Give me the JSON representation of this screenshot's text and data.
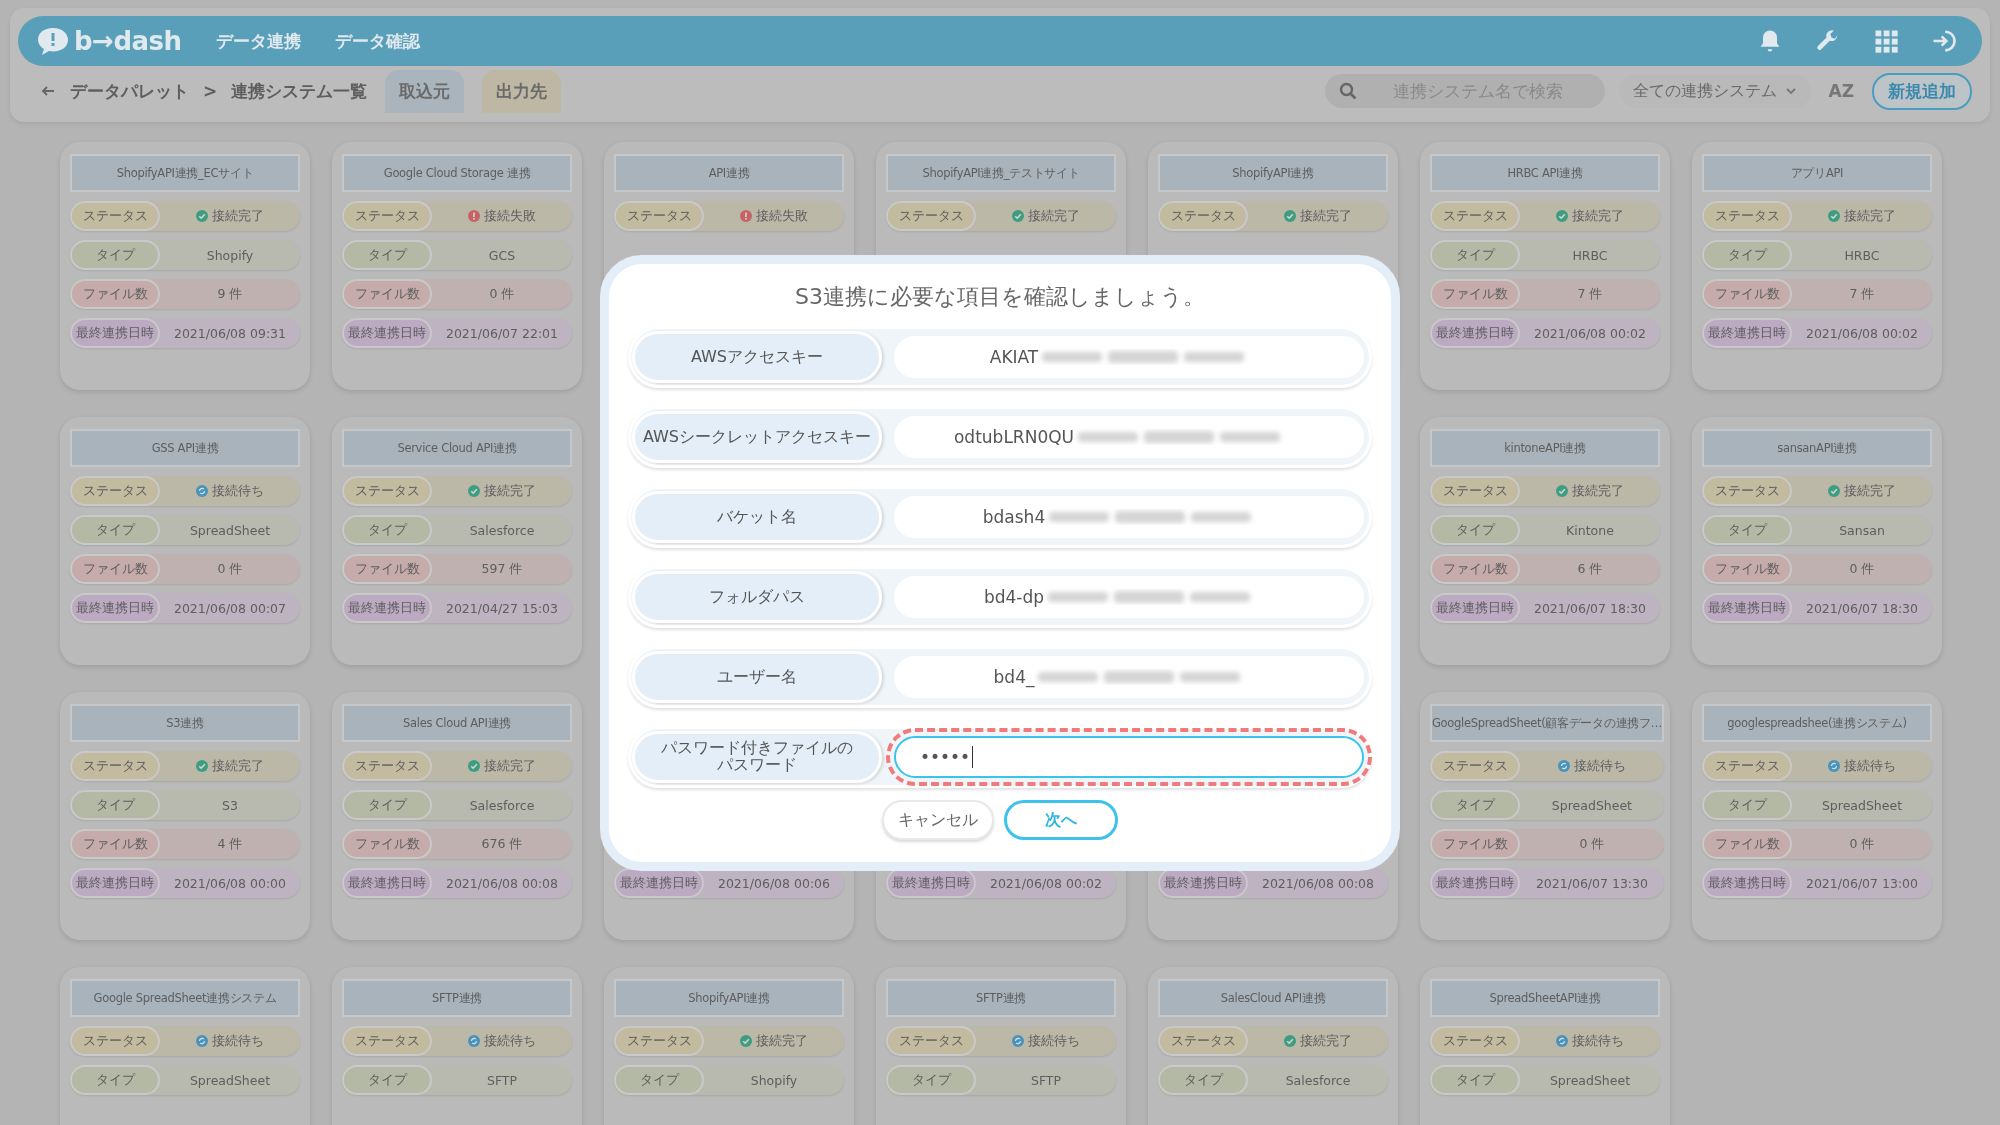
{
  "header": {
    "logo": "b→dash",
    "nav": [
      {
        "label": "データ連携"
      },
      {
        "label": "データ確認"
      }
    ]
  },
  "toolbar": {
    "breadcrumb": [
      "データパレット",
      ">",
      "連携システム一覧"
    ],
    "tabs": [
      {
        "label": "取込元",
        "selected": true
      },
      {
        "label": "出力先",
        "selected": false
      }
    ],
    "search": {
      "placeholder": "連携システム名で検索"
    },
    "filter": "全ての連携システム",
    "sort": "AZ",
    "add_button": "新規追加"
  },
  "left_cards": [
    {
      "title": "ShopifyAPI連携_ECサイト",
      "rows": [
        {
          "kind": "ok",
          "label": "ステータス",
          "value": "接続完了"
        },
        {
          "kind": "type",
          "label": "タイプ",
          "value": "Shopify"
        },
        {
          "kind": "files",
          "label": "ファイル数",
          "value": "9 件"
        },
        {
          "kind": "date",
          "label": "最終連携日時",
          "value": "2021/06/08 09:31"
        }
      ]
    },
    {
      "title": "Google Cloud Storage 連携",
      "rows": [
        {
          "kind": "error",
          "label": "ステータス",
          "value": "接続失敗"
        },
        {
          "kind": "type",
          "label": "タイプ",
          "value": "GCS"
        },
        {
          "kind": "files",
          "label": "ファイル数",
          "value": "0 件"
        },
        {
          "kind": "date",
          "label": "最終連携日時",
          "value": "2021/06/07 22:01"
        }
      ]
    },
    {
      "title": "GSS API連携",
      "rows": [
        {
          "kind": "waiting",
          "label": "ステータス",
          "value": "接続待ち"
        },
        {
          "kind": "type",
          "label": "タイプ",
          "value": "SpreadSheet"
        },
        {
          "kind": "files",
          "label": "ファイル数",
          "value": "0 件"
        },
        {
          "kind": "date",
          "label": "最終連携日時",
          "value": "2021/06/08 00:07"
        }
      ]
    },
    {
      "title": "Service Cloud API連携",
      "rows": [
        {
          "kind": "ok",
          "label": "ステータス",
          "value": "接続完了"
        },
        {
          "kind": "type",
          "label": "タイプ",
          "value": "Salesforce"
        },
        {
          "kind": "files",
          "label": "ファイル数",
          "value": "597 件"
        },
        {
          "kind": "date",
          "label": "最終連携日時",
          "value": "2021/04/27 15:03"
        }
      ]
    },
    {
      "title": "S3連携",
      "rows": [
        {
          "kind": "ok",
          "label": "ステータス",
          "value": "接続完了"
        },
        {
          "kind": "type",
          "label": "タイプ",
          "value": "S3"
        },
        {
          "kind": "files",
          "label": "ファイル数",
          "value": "4 件"
        },
        {
          "kind": "date",
          "label": "最終連携日時",
          "value": "2021/06/08 00:00"
        }
      ]
    },
    {
      "title": "Sales Cloud API連携",
      "rows": [
        {
          "kind": "ok",
          "label": "ステータス",
          "value": "接続完了"
        },
        {
          "kind": "type",
          "label": "タイプ",
          "value": "Salesforce"
        },
        {
          "kind": "files",
          "label": "ファイル数",
          "value": "676 件"
        },
        {
          "kind": "date",
          "label": "最終連携日時",
          "value": "2021/06/08 00:08"
        }
      ]
    },
    {
      "title": "Google SpreadSheet連携システム",
      "rows": [
        {
          "kind": "waiting",
          "label": "ステータス",
          "value": "接続待ち"
        },
        {
          "kind": "type",
          "label": "タイプ",
          "value": "SpreadSheet"
        }
      ]
    },
    {
      "title": "SFTP連携",
      "rows": [
        {
          "kind": "waiting",
          "label": "ステータス",
          "value": "接続待ち"
        },
        {
          "kind": "type",
          "label": "タイプ",
          "value": "SFTP"
        }
      ]
    }
  ],
  "middle_cards": [
    {
      "title": "API連携",
      "rows": [
        {
          "kind": "error",
          "label": "ステータス",
          "value": "接続失敗"
        }
      ]
    },
    {
      "title": "ShopifyAPI連携_テストサイト",
      "rows": [
        {
          "kind": "ok",
          "label": "ステータス",
          "value": "接続完了"
        }
      ]
    },
    {
      "title": "ShopifyAPI連携",
      "rows": [
        {
          "kind": "ok",
          "label": "ステータス",
          "value": "接続完了"
        }
      ]
    },
    {
      "rows": [
        {
          "kind": "date",
          "label": "最終連携日時",
          "value": "2021/06/08 00:06"
        }
      ]
    },
    {
      "rows": [
        {
          "kind": "date",
          "label": "最終連携日時",
          "value": "2021/06/08 00:02"
        }
      ]
    },
    {
      "rows": [
        {
          "kind": "date",
          "label": "最終連携日時",
          "value": "2021/06/08 00:08"
        }
      ]
    },
    {
      "title": "ShopifyAPI連携",
      "rows": [
        {
          "kind": "ok",
          "label": "ステータス",
          "value": "接続完了"
        },
        {
          "kind": "type",
          "label": "タイプ",
          "value": "Shopify"
        }
      ]
    },
    {
      "title": "SFTP連携",
      "rows": [
        {
          "kind": "waiting",
          "label": "ステータス",
          "value": "接続待ち"
        },
        {
          "kind": "type",
          "label": "タイプ",
          "value": "SFTP"
        }
      ]
    },
    {
      "title": "SalesCloud API連携",
      "rows": [
        {
          "kind": "ok",
          "label": "ステータス",
          "value": "接続完了"
        },
        {
          "kind": "type",
          "label": "タイプ",
          "value": "Salesforce"
        }
      ]
    }
  ],
  "right_cards": [
    {
      "title": "HRBC API連携",
      "rows": [
        {
          "kind": "ok",
          "label": "ステータス",
          "value": "接続完了"
        },
        {
          "kind": "type",
          "label": "タイプ",
          "value": "HRBC"
        },
        {
          "kind": "files",
          "label": "ファイル数",
          "value": "7 件"
        },
        {
          "kind": "date",
          "label": "最終連携日時",
          "value": "2021/06/08 00:02"
        }
      ]
    },
    {
      "title": "アプリAPI",
      "rows": [
        {
          "kind": "ok",
          "label": "ステータス",
          "value": "接続完了"
        },
        {
          "kind": "type",
          "label": "タイプ",
          "value": "HRBC"
        },
        {
          "kind": "files",
          "label": "ファイル数",
          "value": "7 件"
        },
        {
          "kind": "date",
          "label": "最終連携日時",
          "value": "2021/06/08 00:02"
        }
      ]
    },
    {
      "title": "kintoneAPI連携",
      "rows": [
        {
          "kind": "ok",
          "label": "ステータス",
          "value": "接続完了"
        },
        {
          "kind": "type",
          "label": "タイプ",
          "value": "Kintone"
        },
        {
          "kind": "files",
          "label": "ファイル数",
          "value": "6 件"
        },
        {
          "kind": "date",
          "label": "最終連携日時",
          "value": "2021/06/07 18:30"
        }
      ]
    },
    {
      "title": "sansanAPI連携",
      "rows": [
        {
          "kind": "ok",
          "label": "ステータス",
          "value": "接続完了"
        },
        {
          "kind": "type",
          "label": "タイプ",
          "value": "Sansan"
        },
        {
          "kind": "files",
          "label": "ファイル数",
          "value": "0 件"
        },
        {
          "kind": "date",
          "label": "最終連携日時",
          "value": "2021/06/07 18:30"
        }
      ]
    },
    {
      "title": "GoogleSpreadSheet(顧客データの連携フ…",
      "rows": [
        {
          "kind": "waiting",
          "label": "ステータス",
          "value": "接続待ち"
        },
        {
          "kind": "type",
          "label": "タイプ",
          "value": "SpreadSheet"
        },
        {
          "kind": "files",
          "label": "ファイル数",
          "value": "0 件"
        },
        {
          "kind": "date",
          "label": "最終連携日時",
          "value": "2021/06/07 13:30"
        }
      ]
    },
    {
      "title": "googlespreadshee(連携システム)",
      "rows": [
        {
          "kind": "waiting",
          "label": "ステータス",
          "value": "接続待ち"
        },
        {
          "kind": "type",
          "label": "タイプ",
          "value": "SpreadSheet"
        },
        {
          "kind": "files",
          "label": "ファイル数",
          "value": "0 件"
        },
        {
          "kind": "date",
          "label": "最終連携日時",
          "value": "2021/06/07 13:00"
        }
      ]
    },
    {
      "title": "SpreadSheetAPI連携",
      "rows": [
        {
          "kind": "waiting",
          "label": "ステータス",
          "value": "接続待ち"
        },
        {
          "kind": "type",
          "label": "タイプ",
          "value": "SpreadSheet"
        }
      ]
    }
  ],
  "dialog": {
    "title": "S3連携に必要な項目を確認しましょう。",
    "fields": [
      {
        "label": "AWSアクセスキー",
        "value": "AKIAT",
        "blurred": true
      },
      {
        "label": "AWSシークレットアクセスキー",
        "value": "odtubLRN0QU",
        "blurred": true
      },
      {
        "label": "バケット名",
        "value": "bdash4",
        "blurred": true
      },
      {
        "label": "フォルダパス",
        "value": "bd4-dp",
        "blurred": true
      },
      {
        "label": "ユーザー名",
        "value": "bd4_",
        "blurred": true
      },
      {
        "label": "パスワード付きファイルのパスワード",
        "value": "•••••",
        "kind": "password",
        "focused": true
      }
    ],
    "buttons": [
      {
        "label": "キャンセル",
        "kind": "secondary"
      },
      {
        "label": "次へ",
        "kind": "primary"
      }
    ]
  }
}
